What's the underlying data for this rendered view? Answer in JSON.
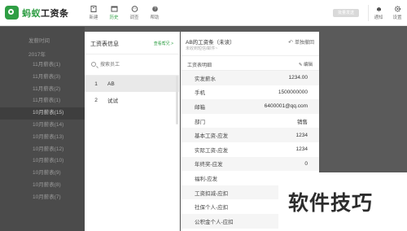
{
  "brand": {
    "name_part1": "蚂蚁",
    "name_part2": "工资条"
  },
  "toolbar": {
    "new_label": "新建",
    "history_label": "历史",
    "settings_label": "调查",
    "help_label": "帮助",
    "export_label": "批量发送",
    "notify_label": "通知",
    "prefs_label": "设置"
  },
  "sidebar": {
    "header": "发薪时间",
    "year": "2017年",
    "items": [
      "11月薪表(1)",
      "11月薪表(3)",
      "11月薪表(2)",
      "11月薪表(1)",
      "10月薪表(15)",
      "10月薪表(14)",
      "10月薪表(13)",
      "10月薪表(12)",
      "10月薪表(10)",
      "10月薪表(9)",
      "10月薪表(8)",
      "10月薪表(7)"
    ],
    "selected_index": 4
  },
  "employees": {
    "title": "工资表信息",
    "link": "查看帮兄 >",
    "search_placeholder": "搜索员工",
    "rows": [
      {
        "num": "1",
        "name": "AB"
      },
      {
        "num": "2",
        "name": "试试"
      }
    ],
    "selected_index": 0
  },
  "detail": {
    "title": "AB的工资条（未读）",
    "subtitle": "未收到短信/邮件~",
    "withdraw_label": "单独撤回",
    "section_title": "工资表明细",
    "edit_label": "编辑",
    "rows": [
      {
        "key": "实发薪水",
        "value": "1234.00"
      },
      {
        "key": "手机",
        "value": "1500000000"
      },
      {
        "key": "邮箱",
        "value": "6400001@qq.com"
      },
      {
        "key": "部门",
        "value": "销售"
      },
      {
        "key": "基本工资-应发",
        "value": "1234"
      },
      {
        "key": "实际工资-应发",
        "value": "1234"
      },
      {
        "key": "年终奖-应发",
        "value": "0"
      },
      {
        "key": "福利-应发",
        "value": ""
      },
      {
        "key": "工资扣减-应扣",
        "value": ""
      },
      {
        "key": "社保个人-应扣",
        "value": ""
      },
      {
        "key": "公积金个人-应扣",
        "value": ""
      }
    ]
  },
  "watermark": {
    "text": "软件技巧"
  }
}
